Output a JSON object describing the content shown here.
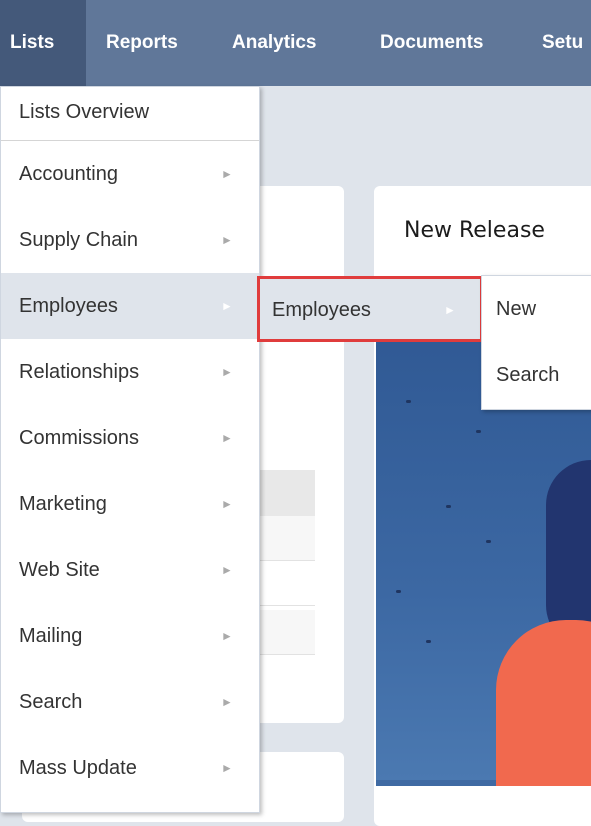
{
  "topnav": {
    "tabs": [
      {
        "label": "Lists"
      },
      {
        "label": "Reports"
      },
      {
        "label": "Analytics"
      },
      {
        "label": "Documents"
      },
      {
        "label": "Setu"
      }
    ]
  },
  "main": {
    "release_title": "New Release"
  },
  "lists_menu": {
    "overview": "Lists Overview",
    "items": [
      {
        "label": "Accounting"
      },
      {
        "label": "Supply Chain"
      },
      {
        "label": "Employees"
      },
      {
        "label": "Relationships"
      },
      {
        "label": "Commissions"
      },
      {
        "label": "Marketing"
      },
      {
        "label": "Web Site"
      },
      {
        "label": "Mailing"
      },
      {
        "label": "Search"
      },
      {
        "label": "Mass Update"
      }
    ],
    "arrow_glyph": "►"
  },
  "employees_submenu": {
    "label": "Employees"
  },
  "employees_actions": {
    "new": "New",
    "search": "Search"
  },
  "colors": {
    "nav_bg": "#607799",
    "nav_active": "#44597a",
    "highlight_border": "#e03c3c"
  }
}
